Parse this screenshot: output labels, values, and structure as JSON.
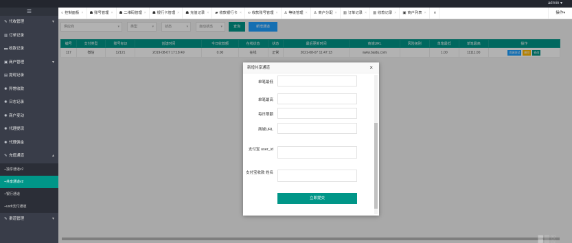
{
  "topbar": {
    "user": "admin ▾"
  },
  "sidebar": {
    "menu_icon": "☰",
    "items": [
      {
        "label": "代收管理",
        "icon": "wrench-icon",
        "glyph": "✎",
        "arrow": "▾"
      },
      {
        "label": "订单记录",
        "icon": "chart-icon",
        "glyph": "▥"
      },
      {
        "label": "收款记录",
        "icon": "card-icon",
        "glyph": "▬"
      },
      {
        "label": "商户管理",
        "icon": "user-icon",
        "glyph": "▣",
        "arrow": "▾"
      },
      {
        "label": "提现记录",
        "icon": "list-icon",
        "glyph": "▤"
      },
      {
        "label": "异常收款",
        "icon": "gear-icon",
        "glyph": "✺"
      },
      {
        "label": "日志记录",
        "icon": "gear-icon",
        "glyph": "✺"
      },
      {
        "label": "商户变动",
        "icon": "gear-icon",
        "glyph": "✺"
      },
      {
        "label": "代理提现",
        "icon": "gear-icon",
        "glyph": "✺"
      },
      {
        "label": "代理佣金",
        "icon": "gear-icon",
        "glyph": "✺"
      },
      {
        "label": "充值通道",
        "icon": "wrench-icon",
        "glyph": "✎",
        "arrow": "▴"
      }
    ],
    "subitems": [
      {
        "label": "独享通道v2",
        "active": false
      },
      {
        "label": "共享通道v2",
        "active": true
      },
      {
        "label": "银行通道",
        "active": false
      },
      {
        "label": "usdt支付通道",
        "active": false
      }
    ],
    "last": {
      "label": "渠道管理",
      "icon": "wrench-icon",
      "glyph": "✎",
      "arrow": "▾"
    }
  },
  "tabs": [
    {
      "label": "控制面板",
      "icon": "home-icon",
      "glyph": "○"
    },
    {
      "label": "账号管理",
      "icon": "users-icon",
      "glyph": "☗"
    },
    {
      "label": "二维码管理",
      "icon": "users-icon",
      "glyph": "☗"
    },
    {
      "label": "银行卡管理",
      "icon": "users-icon",
      "glyph": "☗"
    },
    {
      "label": "充值记录",
      "icon": "users-icon",
      "glyph": "☗"
    },
    {
      "label": "收款银行卡",
      "icon": "book-icon",
      "glyph": "▰"
    },
    {
      "label": "收款账号管理",
      "icon": "link-icon",
      "glyph": "∞"
    },
    {
      "label": "等级管理",
      "icon": "person-icon",
      "glyph": "♙"
    },
    {
      "label": "商户分配",
      "icon": "person-icon",
      "glyph": "♙"
    },
    {
      "label": "订单记录",
      "icon": "chart-icon",
      "glyph": "▥"
    },
    {
      "label": "收款记录",
      "icon": "chart-icon",
      "glyph": "▥"
    },
    {
      "label": "商户列表",
      "icon": "doc-icon",
      "glyph": "▣"
    }
  ],
  "tab_more": "∨",
  "tab_ops": "操作▾",
  "filters": {
    "supplier": "供应商",
    "type": "类型",
    "status": "状态",
    "auto_status": "自动状态",
    "query": "查询",
    "add": "新增通道"
  },
  "table": {
    "headers": [
      "编号",
      "支付类型",
      "账号标识",
      "创建时间",
      "今日收款额",
      "在线状态",
      "状态",
      "最后更新时间",
      "商城URL",
      "风险级别",
      "单笔最低",
      "单笔最高",
      "操作"
    ],
    "rows": [
      {
        "cells": [
          "117",
          "微信",
          "12121",
          "2019-08-07 17:18:49",
          "0.00",
          "在线",
          "正常",
          "2021-08-07 11:47:13",
          "www.baidu.com",
          "",
          "1.00",
          "11111.00"
        ],
        "actions": [
          {
            "label": "资源测试",
            "color": "#1e9fff"
          },
          {
            "label": "删除",
            "color": "#ffb800"
          },
          {
            "label": "修改",
            "color": "#009688"
          }
        ]
      }
    ]
  },
  "modal": {
    "title": "新增共享通道",
    "close": "×",
    "fields": [
      {
        "label": "单笔最低",
        "value": ""
      },
      {
        "label": "单笔最高",
        "value": ""
      },
      {
        "label": "每日限额",
        "value": ""
      },
      {
        "label": "商城URL",
        "value": ""
      },
      {
        "label": "支付宝 user_id",
        "value": ""
      },
      {
        "label": "支付宝收款 姓名",
        "value": ""
      }
    ],
    "submit": "立即提交"
  }
}
